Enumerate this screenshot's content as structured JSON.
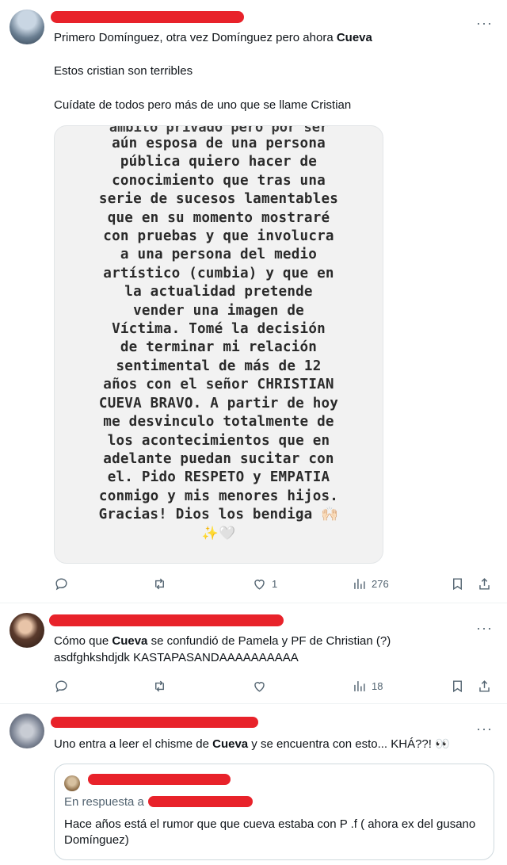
{
  "tweets": [
    {
      "line1_before": "Primero Domínguez, otra vez Domínguez pero ahora ",
      "line1_bold": "Cueva",
      "line2": "Estos cristian son terribles",
      "line3": "Cuídate de todos pero más de uno que se llame Cristian",
      "story": {
        "cut_line": "ámbito privado pero por ser",
        "lines": [
          "aún esposa de una persona",
          "pública quiero hacer de",
          "conocimiento que tras una",
          "serie de sucesos lamentables",
          "que en su momento mostraré",
          "con pruebas y que involucra",
          "a una persona del medio",
          "artístico (cumbia) y que en",
          "la actualidad pretende",
          "vender una imagen de",
          "Víctima.  Tomé la decisión",
          "de terminar mi relación",
          "sentimental de más de 12",
          "años con el señor CHRISTIAN",
          "CUEVA BRAVO. A partir de hoy",
          "me desvinculo totalmente de",
          "los acontecimientos que en",
          "adelante puedan sucitar con",
          "el. Pido RESPETO y EMPATIA",
          "conmigo y mis menores hijos.",
          "Gracias! Dios los bendiga 🙌🏻"
        ],
        "emoji_line": "✨🤍"
      },
      "actions": {
        "reply": "",
        "retweet": "",
        "like": "1",
        "views": "276"
      }
    },
    {
      "line1_before": "Cómo que ",
      "line1_bold": "Cueva",
      "line1_after": " se confundió de Pamela y  PF de Christian (?)",
      "line2": "asdfghkshdjdk  KASTAPASANDAAAAAAAAAA",
      "actions": {
        "reply": "",
        "retweet": "",
        "like": "",
        "views": "18"
      }
    },
    {
      "line1_before": "Uno entra a leer el chisme de ",
      "line1_bold": "Cueva",
      "line1_after": " y se encuentra con esto... KHÁ??! 👀",
      "quote": {
        "reply_prefix": "En respuesta a",
        "text": "Hace años está el rumor que que cueva estaba con P .f ( ahora ex del gusano Domínguez)"
      }
    }
  ],
  "more_glyph": "···",
  "colors": {
    "redaction": "#e8222a",
    "secondary_text": "#536471",
    "border": "#cfd9de"
  }
}
